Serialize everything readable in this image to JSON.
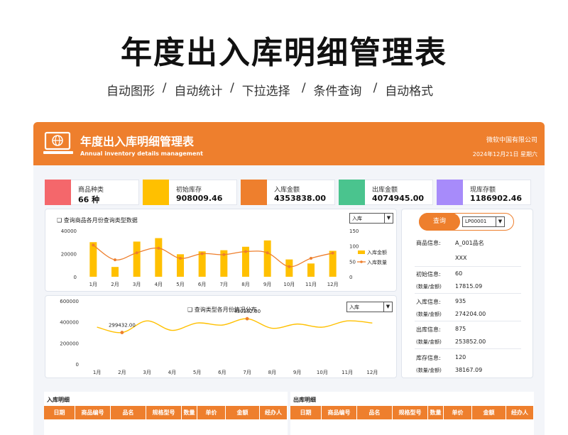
{
  "hero": {
    "title": "年度出入库明细管理表",
    "features": [
      "自动图形",
      "自动统计",
      "下拉选择",
      "条件查询",
      "自动格式"
    ]
  },
  "header": {
    "title": "年度出入库明细管理表",
    "subtitle": "Annual inventory details management",
    "company": "微软中国有限公司",
    "date": "2024年12月21日  星期六",
    "accent": "#ee7f2d"
  },
  "kpis": [
    {
      "label": "商品种类",
      "value": "66  种",
      "color": "#f4676b"
    },
    {
      "label": "初始库存",
      "value": "908009.46",
      "color": "#ffc000"
    },
    {
      "label": "入库金额",
      "value": "4353838.00",
      "color": "#ee7f2d"
    },
    {
      "label": "出库金额",
      "value": "4074945.00",
      "color": "#4ac48e"
    },
    {
      "label": "现库存额",
      "value": "1186902.46",
      "color": "#a78bfa"
    }
  ],
  "chart1": {
    "title": "查询商品各月份查询类型数据",
    "select": "入库"
  },
  "chart2": {
    "title": "查询类型各月份情况分布",
    "select": "入库"
  },
  "query": {
    "button": "查询",
    "code": "LP00001",
    "rows": [
      {
        "label": "商品信息:",
        "value": "A_001品名"
      },
      {
        "label": "",
        "value": "XXX"
      },
      {
        "label": "初始信息:",
        "value": "60"
      },
      {
        "label": "(数量/金额)",
        "value": "17815.09"
      },
      {
        "label": "入库信息:",
        "value": "935"
      },
      {
        "label": "(数量/金额)",
        "value": "274204.00"
      },
      {
        "label": "出库信息:",
        "value": "875"
      },
      {
        "label": "(数量/金额)",
        "value": "253852.00"
      },
      {
        "label": "库存信息:",
        "value": "120"
      },
      {
        "label": "(数量/金额)",
        "value": "38167.09"
      }
    ]
  },
  "tables": {
    "in_title": "入库明细",
    "out_title": "出库明细",
    "in_headers": [
      "日期",
      "商品编号",
      "品名",
      "规格型号",
      "数量",
      "单价",
      "金额",
      "经办人"
    ],
    "out_headers": [
      "日期",
      "商品编号",
      "品名",
      "规格型号",
      "数量",
      "单价",
      "金额",
      "经办人"
    ]
  },
  "chart_data": [
    {
      "type": "bar",
      "categories": [
        "1月",
        "2月",
        "3月",
        "4月",
        "5月",
        "6月",
        "7月",
        "8月",
        "9月",
        "10月",
        "11月",
        "12月"
      ],
      "series": [
        {
          "name": "入库金额",
          "type": "bar",
          "axis": "left",
          "color": "#ffc000",
          "values": [
            30000,
            8500,
            30500,
            33500,
            19500,
            22000,
            23000,
            26000,
            31500,
            15000,
            11500,
            22500
          ]
        },
        {
          "name": "入库数量",
          "type": "line",
          "axis": "right",
          "color": "#ee7f2d",
          "values": [
            103,
            55,
            78,
            93,
            60,
            75,
            72,
            82,
            78,
            33,
            60,
            77
          ]
        }
      ],
      "ylim_left": [
        0,
        40000
      ],
      "yticks_left": [
        0,
        20000,
        40000
      ],
      "ylim_right": [
        0,
        150
      ],
      "yticks_right": [
        0,
        50,
        100,
        150
      ],
      "legend": "right"
    },
    {
      "type": "line",
      "categories": [
        "1月",
        "2月",
        "3月",
        "4月",
        "5月",
        "6月",
        "7月",
        "8月",
        "9月",
        "10月",
        "11月",
        "12月"
      ],
      "series": [
        {
          "name": "",
          "color": "#ffc000",
          "values": [
            350000,
            299432,
            410000,
            320000,
            390000,
            370000,
            430382,
            340000,
            380000,
            350000,
            410000,
            390000
          ]
        }
      ],
      "annotations": [
        {
          "index": 1,
          "text": "299432.00"
        },
        {
          "index": 6,
          "text": "430382.00"
        }
      ],
      "ylim": [
        0,
        600000
      ],
      "yticks": [
        0,
        200000,
        400000,
        600000
      ]
    }
  ]
}
